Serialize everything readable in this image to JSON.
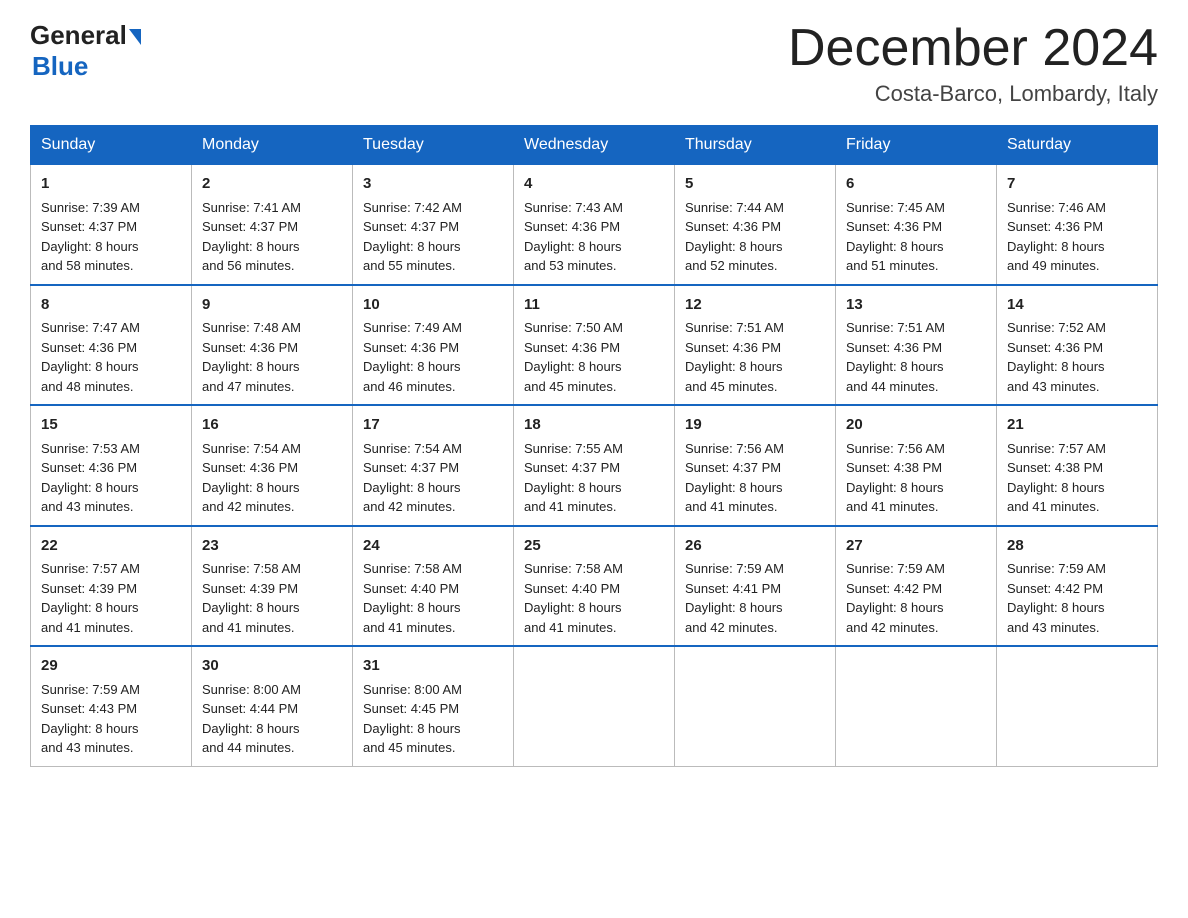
{
  "logo": {
    "general": "General",
    "arrow_symbol": "▶",
    "blue": "Blue"
  },
  "title": "December 2024",
  "location": "Costa-Barco, Lombardy, Italy",
  "days_of_week": [
    "Sunday",
    "Monday",
    "Tuesday",
    "Wednesday",
    "Thursday",
    "Friday",
    "Saturday"
  ],
  "weeks": [
    [
      {
        "day": "1",
        "sunrise": "Sunrise: 7:39 AM",
        "sunset": "Sunset: 4:37 PM",
        "daylight": "Daylight: 8 hours",
        "daylight2": "and 58 minutes."
      },
      {
        "day": "2",
        "sunrise": "Sunrise: 7:41 AM",
        "sunset": "Sunset: 4:37 PM",
        "daylight": "Daylight: 8 hours",
        "daylight2": "and 56 minutes."
      },
      {
        "day": "3",
        "sunrise": "Sunrise: 7:42 AM",
        "sunset": "Sunset: 4:37 PM",
        "daylight": "Daylight: 8 hours",
        "daylight2": "and 55 minutes."
      },
      {
        "day": "4",
        "sunrise": "Sunrise: 7:43 AM",
        "sunset": "Sunset: 4:36 PM",
        "daylight": "Daylight: 8 hours",
        "daylight2": "and 53 minutes."
      },
      {
        "day": "5",
        "sunrise": "Sunrise: 7:44 AM",
        "sunset": "Sunset: 4:36 PM",
        "daylight": "Daylight: 8 hours",
        "daylight2": "and 52 minutes."
      },
      {
        "day": "6",
        "sunrise": "Sunrise: 7:45 AM",
        "sunset": "Sunset: 4:36 PM",
        "daylight": "Daylight: 8 hours",
        "daylight2": "and 51 minutes."
      },
      {
        "day": "7",
        "sunrise": "Sunrise: 7:46 AM",
        "sunset": "Sunset: 4:36 PM",
        "daylight": "Daylight: 8 hours",
        "daylight2": "and 49 minutes."
      }
    ],
    [
      {
        "day": "8",
        "sunrise": "Sunrise: 7:47 AM",
        "sunset": "Sunset: 4:36 PM",
        "daylight": "Daylight: 8 hours",
        "daylight2": "and 48 minutes."
      },
      {
        "day": "9",
        "sunrise": "Sunrise: 7:48 AM",
        "sunset": "Sunset: 4:36 PM",
        "daylight": "Daylight: 8 hours",
        "daylight2": "and 47 minutes."
      },
      {
        "day": "10",
        "sunrise": "Sunrise: 7:49 AM",
        "sunset": "Sunset: 4:36 PM",
        "daylight": "Daylight: 8 hours",
        "daylight2": "and 46 minutes."
      },
      {
        "day": "11",
        "sunrise": "Sunrise: 7:50 AM",
        "sunset": "Sunset: 4:36 PM",
        "daylight": "Daylight: 8 hours",
        "daylight2": "and 45 minutes."
      },
      {
        "day": "12",
        "sunrise": "Sunrise: 7:51 AM",
        "sunset": "Sunset: 4:36 PM",
        "daylight": "Daylight: 8 hours",
        "daylight2": "and 45 minutes."
      },
      {
        "day": "13",
        "sunrise": "Sunrise: 7:51 AM",
        "sunset": "Sunset: 4:36 PM",
        "daylight": "Daylight: 8 hours",
        "daylight2": "and 44 minutes."
      },
      {
        "day": "14",
        "sunrise": "Sunrise: 7:52 AM",
        "sunset": "Sunset: 4:36 PM",
        "daylight": "Daylight: 8 hours",
        "daylight2": "and 43 minutes."
      }
    ],
    [
      {
        "day": "15",
        "sunrise": "Sunrise: 7:53 AM",
        "sunset": "Sunset: 4:36 PM",
        "daylight": "Daylight: 8 hours",
        "daylight2": "and 43 minutes."
      },
      {
        "day": "16",
        "sunrise": "Sunrise: 7:54 AM",
        "sunset": "Sunset: 4:36 PM",
        "daylight": "Daylight: 8 hours",
        "daylight2": "and 42 minutes."
      },
      {
        "day": "17",
        "sunrise": "Sunrise: 7:54 AM",
        "sunset": "Sunset: 4:37 PM",
        "daylight": "Daylight: 8 hours",
        "daylight2": "and 42 minutes."
      },
      {
        "day": "18",
        "sunrise": "Sunrise: 7:55 AM",
        "sunset": "Sunset: 4:37 PM",
        "daylight": "Daylight: 8 hours",
        "daylight2": "and 41 minutes."
      },
      {
        "day": "19",
        "sunrise": "Sunrise: 7:56 AM",
        "sunset": "Sunset: 4:37 PM",
        "daylight": "Daylight: 8 hours",
        "daylight2": "and 41 minutes."
      },
      {
        "day": "20",
        "sunrise": "Sunrise: 7:56 AM",
        "sunset": "Sunset: 4:38 PM",
        "daylight": "Daylight: 8 hours",
        "daylight2": "and 41 minutes."
      },
      {
        "day": "21",
        "sunrise": "Sunrise: 7:57 AM",
        "sunset": "Sunset: 4:38 PM",
        "daylight": "Daylight: 8 hours",
        "daylight2": "and 41 minutes."
      }
    ],
    [
      {
        "day": "22",
        "sunrise": "Sunrise: 7:57 AM",
        "sunset": "Sunset: 4:39 PM",
        "daylight": "Daylight: 8 hours",
        "daylight2": "and 41 minutes."
      },
      {
        "day": "23",
        "sunrise": "Sunrise: 7:58 AM",
        "sunset": "Sunset: 4:39 PM",
        "daylight": "Daylight: 8 hours",
        "daylight2": "and 41 minutes."
      },
      {
        "day": "24",
        "sunrise": "Sunrise: 7:58 AM",
        "sunset": "Sunset: 4:40 PM",
        "daylight": "Daylight: 8 hours",
        "daylight2": "and 41 minutes."
      },
      {
        "day": "25",
        "sunrise": "Sunrise: 7:58 AM",
        "sunset": "Sunset: 4:40 PM",
        "daylight": "Daylight: 8 hours",
        "daylight2": "and 41 minutes."
      },
      {
        "day": "26",
        "sunrise": "Sunrise: 7:59 AM",
        "sunset": "Sunset: 4:41 PM",
        "daylight": "Daylight: 8 hours",
        "daylight2": "and 42 minutes."
      },
      {
        "day": "27",
        "sunrise": "Sunrise: 7:59 AM",
        "sunset": "Sunset: 4:42 PM",
        "daylight": "Daylight: 8 hours",
        "daylight2": "and 42 minutes."
      },
      {
        "day": "28",
        "sunrise": "Sunrise: 7:59 AM",
        "sunset": "Sunset: 4:42 PM",
        "daylight": "Daylight: 8 hours",
        "daylight2": "and 43 minutes."
      }
    ],
    [
      {
        "day": "29",
        "sunrise": "Sunrise: 7:59 AM",
        "sunset": "Sunset: 4:43 PM",
        "daylight": "Daylight: 8 hours",
        "daylight2": "and 43 minutes."
      },
      {
        "day": "30",
        "sunrise": "Sunrise: 8:00 AM",
        "sunset": "Sunset: 4:44 PM",
        "daylight": "Daylight: 8 hours",
        "daylight2": "and 44 minutes."
      },
      {
        "day": "31",
        "sunrise": "Sunrise: 8:00 AM",
        "sunset": "Sunset: 4:45 PM",
        "daylight": "Daylight: 8 hours",
        "daylight2": "and 45 minutes."
      },
      null,
      null,
      null,
      null
    ]
  ]
}
